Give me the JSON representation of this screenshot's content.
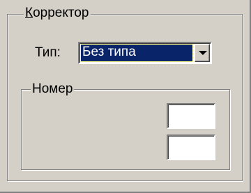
{
  "corrector_group": {
    "title": "Корректор"
  },
  "type_field": {
    "label": "Тип:",
    "selected_value": "Без типа"
  },
  "number_group": {
    "title": "Номер",
    "field1_value": "",
    "field2_value": ""
  },
  "colors": {
    "face": "#d4d0c8",
    "selection": "#0a246a"
  }
}
